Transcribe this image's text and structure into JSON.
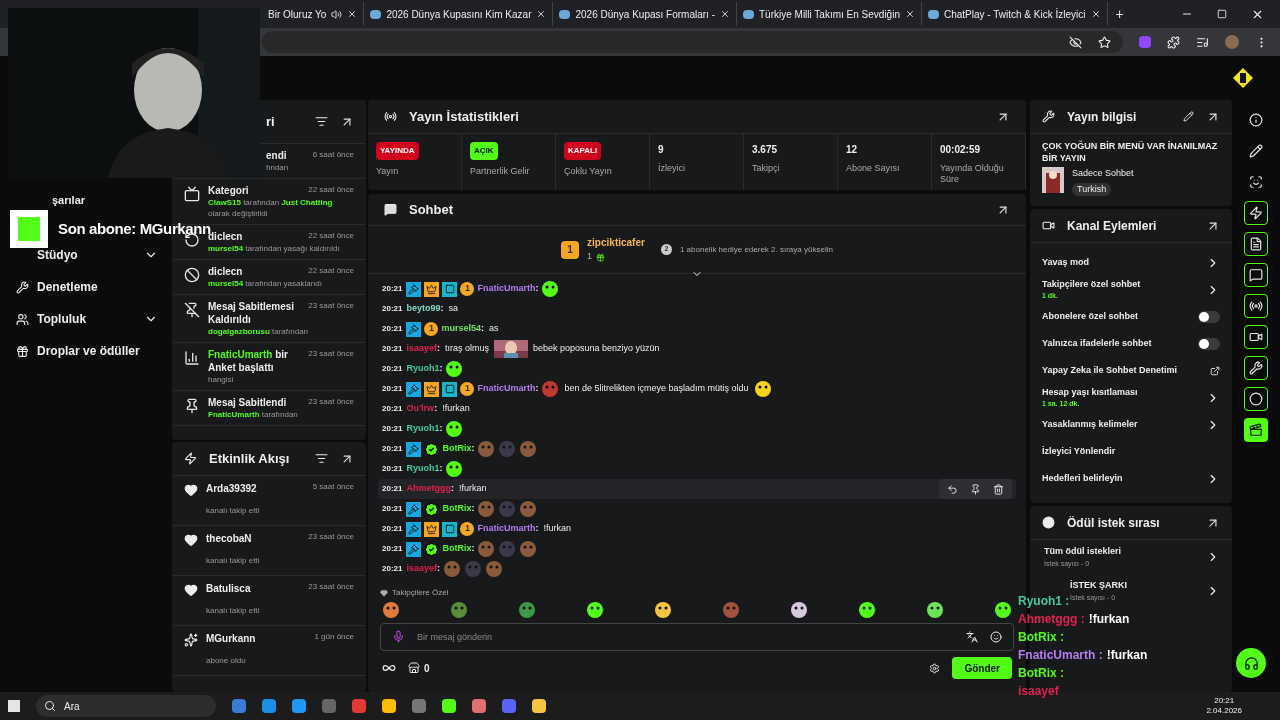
{
  "browser": {
    "tabs": [
      {
        "title": "Bir Oluruz Yo",
        "audio": true
      },
      {
        "title": "2026 Dünya Kupasını Kim Kazar",
        "audio": false
      },
      {
        "title": "2026 Dünya Kupası Formaları -",
        "audio": false
      },
      {
        "title": "Türkiye Milli Takımı En Sevdiğin",
        "audio": false
      },
      {
        "title": "ChatPlay - Twitch & Kick İzleyici",
        "audio": false
      }
    ],
    "new_tab": "+"
  },
  "sidebar": {
    "items": [
      {
        "label": "Stüdyo",
        "expandable": true,
        "kind": "plain"
      },
      {
        "label": "Denetleme",
        "expandable": false,
        "kind": "moderation"
      },
      {
        "label": "Topluluk",
        "expandable": true,
        "kind": "community"
      },
      {
        "label": "Droplar ve ödüller",
        "expandable": false,
        "kind": "rewards"
      }
    ]
  },
  "overlay": {
    "last_sub": "Son abone: MGurkann",
    "behind_text": "şarılar"
  },
  "mod_log": {
    "title": "ri",
    "items": [
      {
        "title": "endi",
        "detail": [
          {
            "text": "fından",
            "accent": false
          }
        ],
        "time": "6 saat önce"
      },
      {
        "kind": "category",
        "title": "Kategori",
        "detail": [
          {
            "text": "ClawS15",
            "accent": true
          },
          {
            "text": " tarafından ",
            "accent": false
          },
          {
            "text": "Just Chatting",
            "accent": true
          },
          {
            "text": " olarak değiştirildi",
            "accent": false
          }
        ],
        "time": "22 saat önce"
      },
      {
        "kind": "unban",
        "title": "diclecn",
        "detail": [
          {
            "text": "mursel54",
            "accent": true
          },
          {
            "text": " tarafından yasağı kaldırıldı",
            "accent": false
          }
        ],
        "time": "22 saat önce"
      },
      {
        "kind": "ban",
        "title": "diclecn",
        "detail": [
          {
            "text": "mursel54",
            "accent": true
          },
          {
            "text": " tarafından yasaklandı",
            "accent": false
          }
        ],
        "time": "22 saat önce"
      },
      {
        "kind": "unpin",
        "title": "Mesaj Sabitlemesi Kaldırıldı",
        "detail": [
          {
            "text": "dogalgazborusu",
            "accent": true
          },
          {
            "text": " tarafından",
            "accent": false
          }
        ],
        "time": "23 saat önce"
      },
      {
        "kind": "poll",
        "title_accent": "FnaticUmarth",
        "title": "bir Anket başlattı",
        "detail": [
          {
            "text": "hangisi",
            "accent": false
          }
        ],
        "time": "23 saat önce"
      },
      {
        "kind": "pin",
        "title": "Mesaj Sabitlendi",
        "detail": [
          {
            "text": "FnaticUmarth",
            "accent": true
          },
          {
            "text": " tarafından",
            "accent": false
          }
        ],
        "time": "23 saat önce"
      }
    ]
  },
  "events": {
    "title": "Etkinlik Akışı",
    "items": [
      {
        "kind": "follow",
        "user": "Arda39392",
        "action": "kanalı takip etti",
        "time": "5 saat önce"
      },
      {
        "kind": "follow",
        "user": "thecobaN",
        "action": "kanalı takip etti",
        "time": "23 saat önce"
      },
      {
        "kind": "follow",
        "user": "Batulisca",
        "action": "kanalı takip etti",
        "time": "23 saat önce"
      },
      {
        "kind": "subscribe",
        "user": "MGurkann",
        "action": "abone oldu",
        "time": "1 gün önce"
      }
    ]
  },
  "stats": {
    "title": "Yayın İstatistikleri",
    "cells": [
      {
        "kind": "badge",
        "value": "YAYINDA",
        "color": "#d0021b",
        "label": "Yayın"
      },
      {
        "kind": "badge",
        "value": "AÇIK",
        "color": "#53fc18",
        "label": "Partnerlik Gelir"
      },
      {
        "kind": "badge",
        "value": "KAPALI",
        "color": "#d0021b",
        "label": "Çoklu Yayın"
      },
      {
        "kind": "number",
        "value": "9",
        "label": "İzleyici"
      },
      {
        "kind": "number",
        "value": "3.675",
        "label": "Takipçi"
      },
      {
        "kind": "number",
        "value": "12",
        "label": "Abone Sayısı"
      },
      {
        "kind": "number",
        "value": "00:02:59",
        "label": "Yayında Olduğu Süre"
      }
    ]
  },
  "chat": {
    "title": "Sohbet",
    "leader": {
      "rank": "1",
      "user": "zipcikticafer",
      "count": "1",
      "next_rank": "2",
      "hint": "1 abonelik hediye ederek 2. sıraya yükselin"
    },
    "messages": [
      {
        "time": "20:21",
        "badges": [
          {
            "kind": "mod"
          },
          {
            "kind": "crown"
          },
          {
            "kind": "og"
          },
          {
            "kind": "sub",
            "label": "1"
          }
        ],
        "user": "FnaticUmarth",
        "sep": ":",
        "color": "#b57cf2",
        "hovered": false,
        "parts": [
          {
            "kind": "emote",
            "color": "#53fc18"
          }
        ]
      },
      {
        "time": "20:21",
        "user": "beyto99",
        "sep": ":",
        "color": "#7fd6c2",
        "hovered": false,
        "parts": [
          {
            "kind": "text",
            "text": "sa"
          }
        ]
      },
      {
        "time": "20:21",
        "badges": [
          {
            "kind": "mod"
          },
          {
            "kind": "sub",
            "label": "1"
          }
        ],
        "user": "mursel54",
        "sep": ":",
        "color": "#6ee35a",
        "hovered": false,
        "parts": [
          {
            "kind": "text",
            "text": "as"
          }
        ]
      },
      {
        "time": "20:21",
        "user": "isaayef",
        "sep": ":",
        "color": "#e0214c",
        "hovered": false,
        "parts": [
          {
            "kind": "text",
            "text": "tıraş olmuş"
          },
          {
            "kind": "picture"
          },
          {
            "kind": "text",
            "text": "bebek poposuna benziyo yüzün"
          }
        ]
      },
      {
        "time": "20:21",
        "user": "Ryuoh1",
        "sep": ":",
        "color": "#45c99b",
        "hovered": false,
        "parts": [
          {
            "kind": "emote",
            "color": "#53fc18"
          }
        ]
      },
      {
        "time": "20:21",
        "badges": [
          {
            "kind": "mod"
          },
          {
            "kind": "crown"
          },
          {
            "kind": "og"
          },
          {
            "kind": "sub",
            "label": "1"
          }
        ],
        "user": "FnaticUmarth",
        "sep": ":",
        "color": "#b57cf2",
        "hovered": false,
        "parts": [
          {
            "kind": "emote",
            "color": "#c0392b"
          },
          {
            "kind": "text",
            "text": "ben de 5litrelikten içmeye başladım mütiş oldu"
          },
          {
            "kind": "emote",
            "color": "#f5d51c"
          }
        ]
      },
      {
        "time": "20:21",
        "user": "Ou'lrw",
        "sep": ":",
        "color": "#e0214c",
        "hovered": false,
        "parts": [
          {
            "kind": "text",
            "text": "!furkan"
          }
        ]
      },
      {
        "time": "20:21",
        "user": "Ryuoh1",
        "sep": ":",
        "color": "#45c99b",
        "hovered": false,
        "parts": [
          {
            "kind": "emote",
            "color": "#53fc18"
          }
        ]
      },
      {
        "time": "20:21",
        "badges": [
          {
            "kind": "mod"
          },
          {
            "kind": "verified"
          }
        ],
        "user": "BotRix",
        "sep": ":",
        "color": "#53fc18",
        "hovered": false,
        "parts": [
          {
            "kind": "emote",
            "color": "#8a5a3c"
          },
          {
            "kind": "emote",
            "color": "#3a3a4a"
          },
          {
            "kind": "emote",
            "color": "#8a5a3c"
          }
        ]
      },
      {
        "time": "20:21",
        "user": "Ryuoh1",
        "sep": ":",
        "color": "#45c99b",
        "hovered": false,
        "parts": [
          {
            "kind": "emote",
            "color": "#53fc18"
          }
        ]
      },
      {
        "time": "20:21",
        "user": "Ahmetggg",
        "sep": ":",
        "color": "#e0214c",
        "hovered": true,
        "parts": [
          {
            "kind": "text",
            "text": "!furkan"
          }
        ]
      },
      {
        "time": "20:21",
        "badges": [
          {
            "kind": "mod"
          },
          {
            "kind": "verified"
          }
        ],
        "user": "BotRix",
        "sep": ":",
        "color": "#53fc18",
        "hovered": false,
        "parts": [
          {
            "kind": "emote",
            "color": "#8a5a3c"
          },
          {
            "kind": "emote",
            "color": "#3a3a4a"
          },
          {
            "kind": "emote",
            "color": "#8a5a3c"
          }
        ]
      },
      {
        "time": "20:21",
        "badges": [
          {
            "kind": "mod"
          },
          {
            "kind": "crown"
          },
          {
            "kind": "og"
          },
          {
            "kind": "sub",
            "label": "1"
          }
        ],
        "user": "FnaticUmarth",
        "sep": ":",
        "color": "#b57cf2",
        "hovered": false,
        "parts": [
          {
            "kind": "text",
            "text": "!furkan"
          }
        ]
      },
      {
        "time": "20:21",
        "badges": [
          {
            "kind": "mod"
          },
          {
            "kind": "verified"
          }
        ],
        "user": "BotRix",
        "sep": ":",
        "color": "#53fc18",
        "hovered": false,
        "parts": [
          {
            "kind": "emote",
            "color": "#8a5a3c"
          },
          {
            "kind": "emote",
            "color": "#3a3a4a"
          },
          {
            "kind": "emote",
            "color": "#8a5a3c"
          }
        ]
      },
      {
        "time": "20:21",
        "user": "isaayef",
        "sep": ":",
        "color": "#e0214c",
        "hovered": false,
        "parts": [
          {
            "kind": "emote",
            "color": "#8a5a3c"
          },
          {
            "kind": "emote",
            "color": "#3a3a4a"
          },
          {
            "kind": "emote",
            "color": "#8a5a3c"
          }
        ]
      }
    ],
    "emote_section": "Takipçilere Özel",
    "emote_bar": [
      {
        "color": "#e07b39"
      },
      {
        "color": "#5b8c3a"
      },
      {
        "color": "#3c9a45"
      },
      {
        "color": "#53fc18"
      },
      {
        "color": "#f5c542"
      },
      {
        "color": "#a0523d"
      },
      {
        "color": "#d9c7e0"
      },
      {
        "color": "#53fc18"
      },
      {
        "color": "#6de35a"
      },
      {
        "color": "#53fc18"
      }
    ],
    "input": {
      "placeholder": "Bir mesaj gönderin"
    },
    "points": "0",
    "send": "Gönder"
  },
  "stream_info": {
    "title": "Yayın bilgisi",
    "stream_title": "ÇOK YOĞUN BİR MENÜ VAR İNANILMAZ BİR YAYIN",
    "category": "Sadece Sohbet",
    "tag": "Turkish"
  },
  "channel_actions": {
    "title": "Kanal Eylemleri",
    "items": [
      {
        "kind": "link",
        "label": "Yavaş mod"
      },
      {
        "kind": "link",
        "label": "Takipçilere özel sohbet",
        "sub": "1 dk."
      },
      {
        "kind": "toggle",
        "label": "Abonelere özel sohbet",
        "on": false
      },
      {
        "kind": "toggle",
        "label": "Yalnızca ifadelerle sohbet",
        "on": false
      },
      {
        "kind": "external",
        "label": "Yapay Zeka ile Sohbet Denetimi"
      },
      {
        "kind": "link",
        "label": "Hesap yaşı kısıtlaması",
        "sub": "1 sa. 12 dk."
      },
      {
        "kind": "link",
        "label": "Yasaklanmış kelimeler"
      },
      {
        "kind": "plain",
        "label": "İzleyici Yönlendir"
      },
      {
        "kind": "link",
        "label": "Hedefleri belirleyin"
      }
    ]
  },
  "rewards": {
    "title": "Ödül istek sırası",
    "items": [
      {
        "label": "Tüm ödül istekleri",
        "sub": "İstek sayısı - 0"
      },
      {
        "label": "İSTEK ŞARKI",
        "sub": "İstek sayısı - 0"
      }
    ]
  },
  "rail": [
    {
      "kind": "info",
      "selected": false
    },
    {
      "kind": "edit",
      "selected": false
    },
    {
      "kind": "scan",
      "selected": false
    },
    {
      "kind": "quick",
      "selected": false
    },
    {
      "kind": "notes",
      "selected": false
    },
    {
      "kind": "chat",
      "selected": false
    },
    {
      "kind": "broadcast",
      "selected": false
    },
    {
      "kind": "channel",
      "selected": false
    },
    {
      "kind": "tools",
      "selected": false
    },
    {
      "kind": "rewards",
      "selected": false
    },
    {
      "kind": "clips",
      "selected": true
    }
  ],
  "chat_overlay": [
    {
      "user": "Ryuoh1",
      "sep": ":",
      "color": "#45c99b"
    },
    {
      "user": "Ahmetggg",
      "sep": ":",
      "color": "#e0214c",
      "text": "!furkan"
    },
    {
      "user": "BotRix",
      "sep": ":",
      "color": "#53fc18"
    },
    {
      "user": "FnaticUmarth",
      "sep": ":",
      "color": "#b57cf2",
      "text": "!furkan"
    },
    {
      "user": "BotRix",
      "sep": ":",
      "color": "#53fc18"
    },
    {
      "user": "isaayef",
      "color": "#e0214c"
    }
  ],
  "taskbar": {
    "search": "Ara",
    "time": "20:21",
    "date": "2.04.2026"
  }
}
